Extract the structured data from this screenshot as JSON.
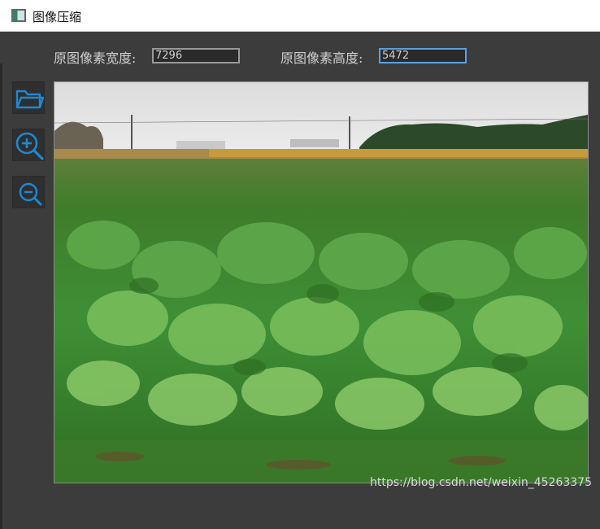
{
  "window": {
    "title": "图像压缩",
    "icon": "image-window-icon"
  },
  "fields": {
    "width_label": "原图像素宽度:",
    "width_value": "7296",
    "height_label": "原图像素高度:",
    "height_value": "5472"
  },
  "toolbar": {
    "open_icon": "folder-open-icon",
    "zoom_in_icon": "zoom-in-icon",
    "zoom_out_icon": "zoom-out-icon"
  },
  "image": {
    "description_icon": "photo"
  },
  "watermark": "https://blog.csdn.net/weixin_45263375",
  "colors": {
    "accent": "#1e88d4",
    "background": "#3c3c3c"
  }
}
